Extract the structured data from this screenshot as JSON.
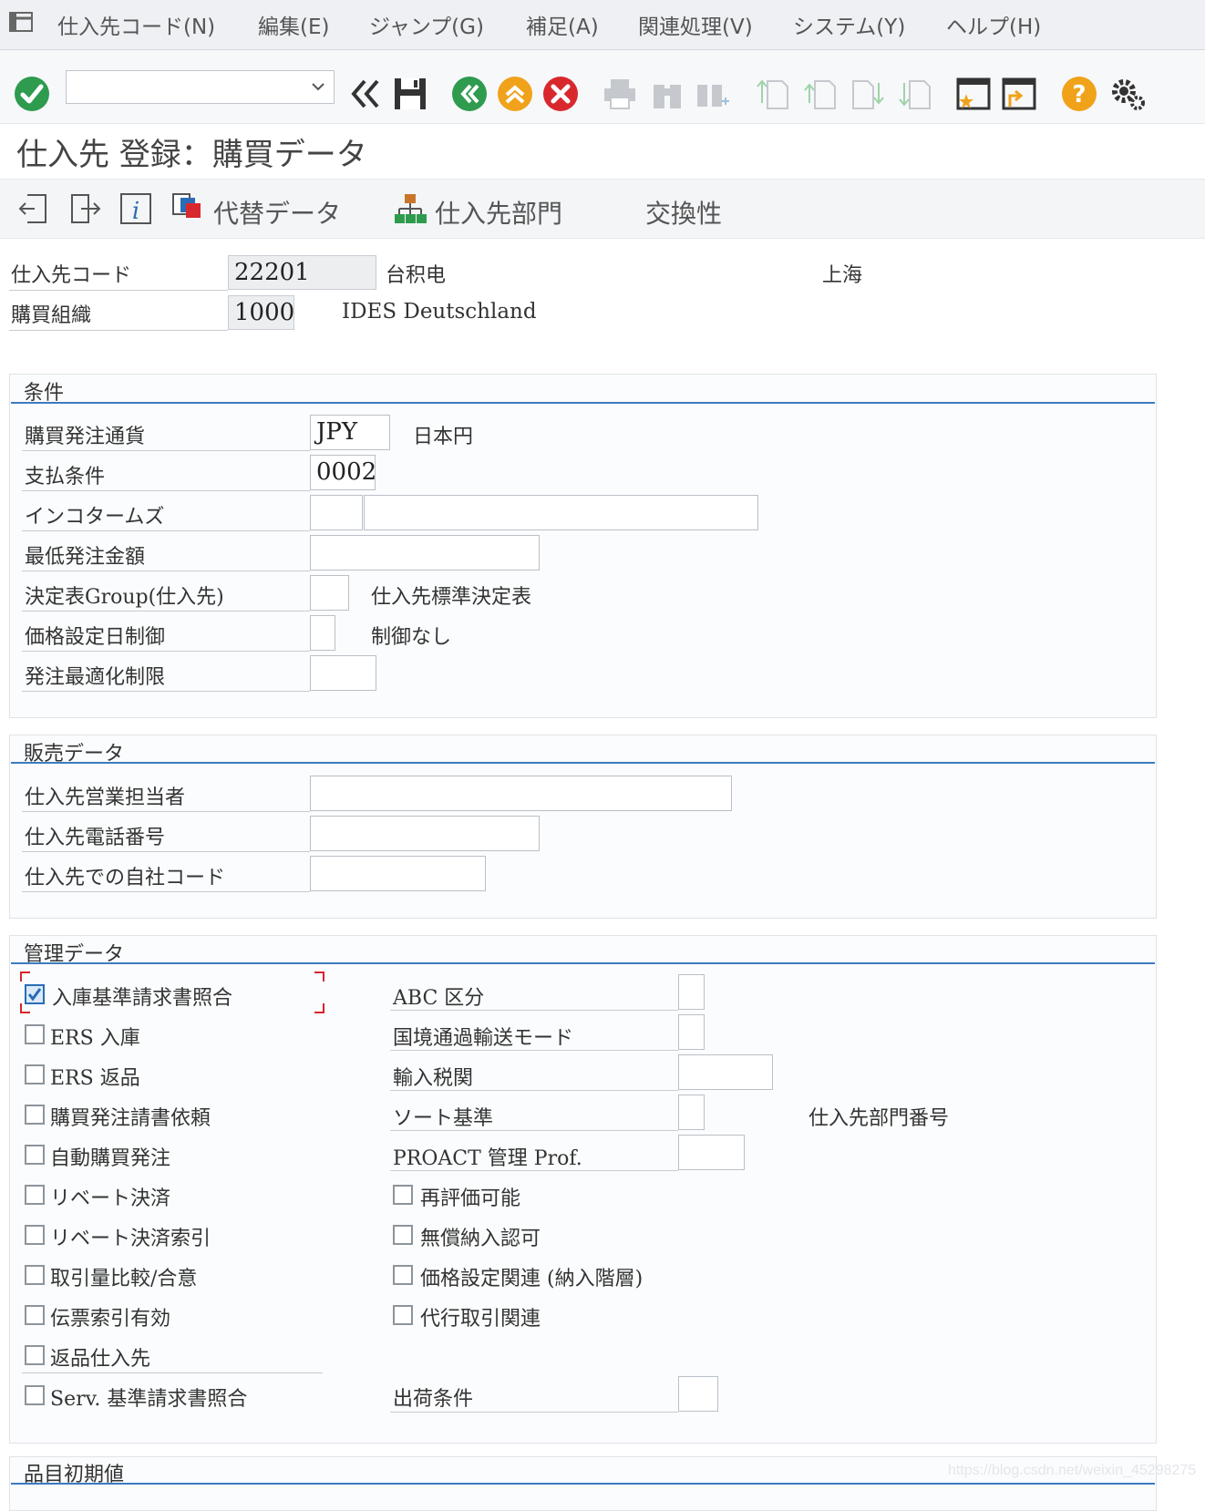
{
  "menu": {
    "items": [
      "仕入先コード(N)",
      "編集(E)",
      "ジャンプ(G)",
      "補足(A)",
      "関連処理(V)",
      "システム(Y)",
      "ヘルプ(H)"
    ]
  },
  "toolbar": {
    "combo_value": ""
  },
  "page": {
    "title": "仕入先 登録：購買データ"
  },
  "subtoolbar": {
    "alt_data": "代替データ",
    "vendor_dept": "仕入先部門",
    "interchangeability": "交換性"
  },
  "header": {
    "vendor_label": "仕入先コード",
    "vendor_value": "22201",
    "vendor_name": "台积电",
    "vendor_city": "上海",
    "purch_org_label": "購買組織",
    "purch_org_value": "1000",
    "purch_org_name": "IDES Deutschland"
  },
  "conditions": {
    "title": "条件",
    "po_currency_label": "購買発注通貨",
    "po_currency_value": "JPY",
    "po_currency_text": "日本円",
    "payment_terms_label": "支払条件",
    "payment_terms_value": "0002",
    "incoterms_label": "インコタームズ",
    "incoterms_value1": "",
    "incoterms_value2": "",
    "min_order_label": "最低発注金額",
    "min_order_value": "",
    "schema_group_label": "決定表Group(仕入先)",
    "schema_group_value": "",
    "schema_group_text": "仕入先標準決定表",
    "pricing_date_label": "価格設定日制御",
    "pricing_date_value": "",
    "pricing_date_text": "制御なし",
    "order_opt_label": "発注最適化制限",
    "order_opt_value": ""
  },
  "sales": {
    "title": "販売データ",
    "salesperson_label": "仕入先営業担当者",
    "salesperson_value": "",
    "phone_label": "仕入先電話番号",
    "phone_value": "",
    "account_label": "仕入先での自社コード",
    "account_value": ""
  },
  "control": {
    "title": "管理データ",
    "gr_based_iv": "入庫基準請求書照合",
    "ers_gr": "ERS 入庫",
    "ers_return": "ERS 返品",
    "ack_reqd": "購買発注請書依頼",
    "auto_po": "自動購買発注",
    "rebate": "リベート決済",
    "rebate_index": "リベート決済索引",
    "volume_compare": "取引量比較/合意",
    "doc_index": "伝票索引有効",
    "return_vendor": "返品仕入先",
    "srv_based_iv": "Serv. 基準請求書照合",
    "abc_label": "ABC 区分",
    "abc_value": "",
    "transport_label": "国境通過輸送モード",
    "transport_value": "",
    "customs_label": "輸入税関",
    "customs_value": "",
    "sort_label": "ソート基準",
    "sort_value": "",
    "sort_text": "仕入先部門番号",
    "proact_label": "PROACT 管理 Prof.",
    "proact_value": "",
    "revaluation": "再評価可能",
    "free_goods": "無償納入認可",
    "pricing_hier": "価格設定関連 (納入階層)",
    "agency_business": "代行取引関連",
    "shipping_label": "出荷条件",
    "shipping_value": "",
    "checked": {
      "gr_based_iv": true
    }
  },
  "item_defaults": {
    "title": "品目初期値"
  },
  "watermark": "https://blog.csdn.net/weixin_45298275"
}
